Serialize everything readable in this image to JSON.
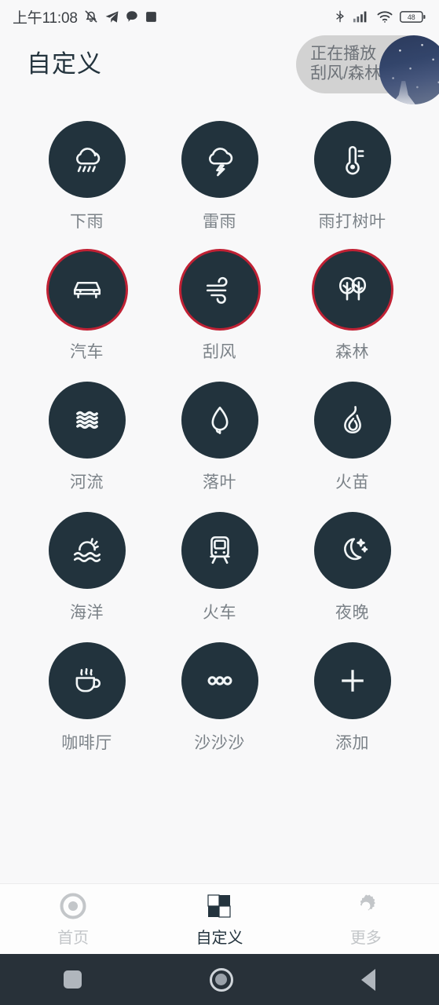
{
  "status_bar": {
    "clock": "上午11:08",
    "left_icons": [
      "bell-muted-icon",
      "telegram-send-icon",
      "chat-bubble-icon",
      "app-square-icon"
    ],
    "right_icons": [
      "bluetooth-icon",
      "signal-bars-icon",
      "wifi-icon",
      "battery-icon"
    ],
    "battery_level": "48"
  },
  "header": {
    "title": "自定义",
    "now_playing": {
      "status_label": "正在播放",
      "track_label": "刮风/森林",
      "thumbnail": "night-sky-thumbnail"
    }
  },
  "colors": {
    "page_background": "#f8f8f9",
    "bubble_fill": "#22333d",
    "active_ring": "#c02134",
    "label_text": "#7b8288",
    "title_text": "#24343e",
    "navbar_background": "#283139",
    "pill_background": "#d2d2d2"
  },
  "sounds": [
    {
      "label": "下雨",
      "icon": "rain-cloud-icon",
      "active": false
    },
    {
      "label": "雷雨",
      "icon": "thunder-cloud-icon",
      "active": false
    },
    {
      "label": "雨打树叶",
      "icon": "thermometer-icon",
      "active": false
    },
    {
      "label": "汽车",
      "icon": "car-icon",
      "active": true
    },
    {
      "label": "刮风",
      "icon": "wind-icon",
      "active": true
    },
    {
      "label": "森林",
      "icon": "trees-icon",
      "active": true
    },
    {
      "label": "河流",
      "icon": "water-waves-icon",
      "active": false
    },
    {
      "label": "落叶",
      "icon": "leaf-icon",
      "active": false
    },
    {
      "label": "火苗",
      "icon": "flame-icon",
      "active": false
    },
    {
      "label": "海洋",
      "icon": "ocean-sun-icon",
      "active": false
    },
    {
      "label": "火车",
      "icon": "train-icon",
      "active": false
    },
    {
      "label": "夜晚",
      "icon": "moon-stars-icon",
      "active": false
    },
    {
      "label": "咖啡厅",
      "icon": "coffee-cup-icon",
      "active": false
    },
    {
      "label": "沙沙沙",
      "icon": "three-dots-icon",
      "active": false
    },
    {
      "label": "添加",
      "icon": "plus-icon",
      "active": false
    }
  ],
  "tabs": [
    {
      "label": "首页",
      "icon": "record-circle-icon",
      "active": false
    },
    {
      "label": "自定义",
      "icon": "checkerboard-icon",
      "active": true
    },
    {
      "label": "更多",
      "icon": "gear-icon",
      "active": false
    }
  ],
  "system_nav": {
    "recents": "recents-square-icon",
    "home": "home-circle-icon",
    "back": "back-triangle-icon"
  }
}
